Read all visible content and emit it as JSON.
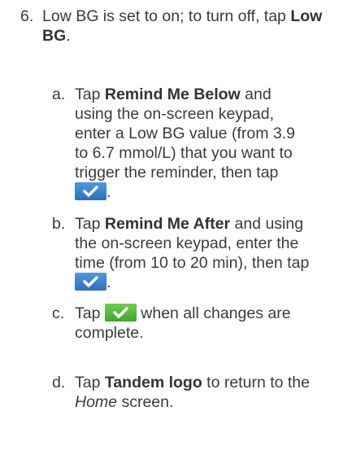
{
  "step": {
    "number": "6.",
    "text_before": "Low BG is set to on; to turn off, tap ",
    "bold": "Low BG",
    "text_after": "."
  },
  "substeps": [
    {
      "letter": "a.",
      "t1": "Tap ",
      "b1": "Remind Me Below",
      "t2": " and using the on-screen keypad, enter a Low BG value (from 3.9 to 6.7 mmol/L) that you want to trigger the reminder, then tap ",
      "t3": "."
    },
    {
      "letter": "b.",
      "t1": "Tap ",
      "b1": "Remind Me After",
      "t2": " and using the on-screen keypad, enter the time (from 10 to 20 min), then tap ",
      "t3": "."
    },
    {
      "letter": "c.",
      "t1": "Tap ",
      "t2": " when all changes are complete."
    },
    {
      "letter": "d.",
      "t1": "Tap ",
      "b1": "Tandem logo",
      "t2": " to return to the ",
      "i1": "Home",
      "t3": " screen."
    }
  ],
  "icons": {
    "confirm_blue": {
      "name": "checkmark-icon",
      "color": "#2f74c4"
    },
    "confirm_green": {
      "name": "checkmark-icon",
      "color": "#4cb82f"
    }
  }
}
